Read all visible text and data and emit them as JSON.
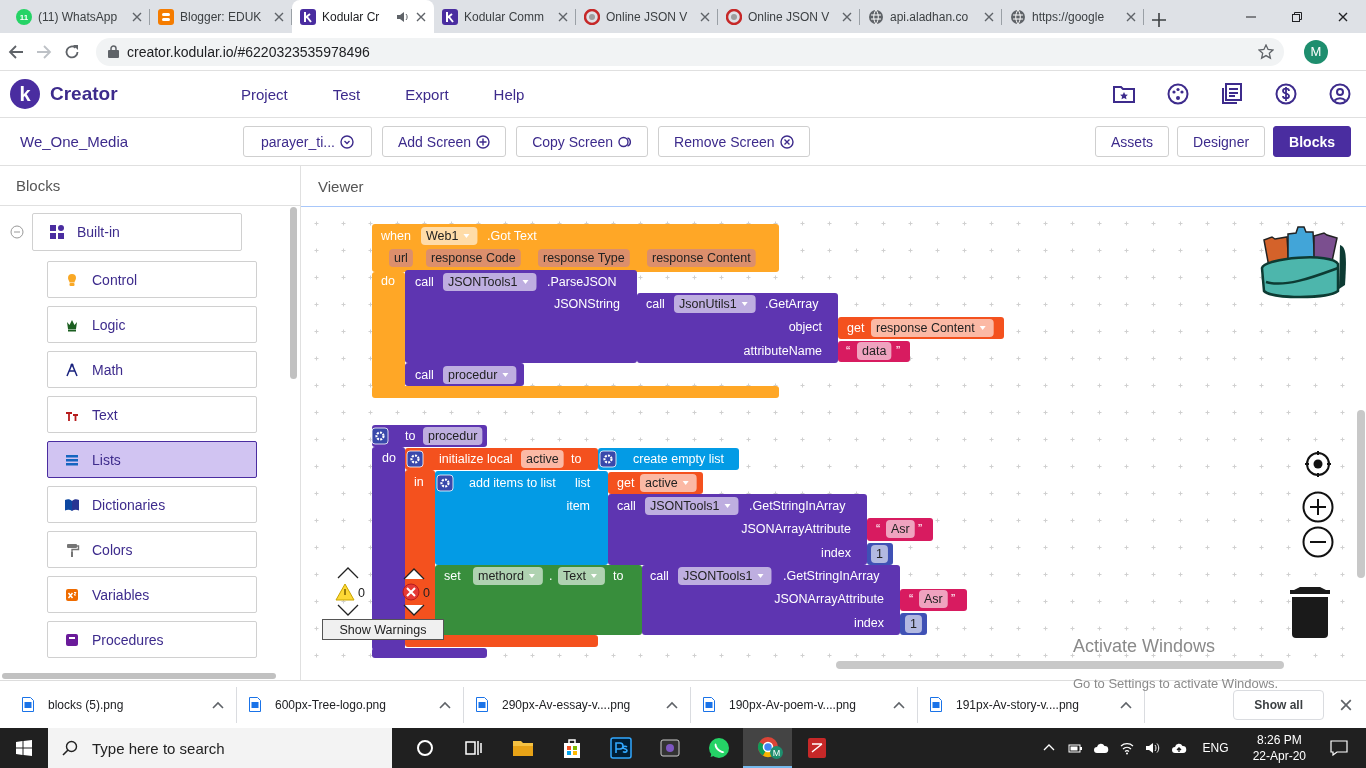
{
  "browser": {
    "tabs": [
      {
        "title": "(11) WhatsApp",
        "badge": "11",
        "selected": false,
        "audio": false
      },
      {
        "title": "Blogger: EDUK",
        "selected": false,
        "audio": false
      },
      {
        "title": "Kodular Cr",
        "selected": true,
        "audio": true
      },
      {
        "title": "Kodular Comm",
        "selected": false,
        "audio": false
      },
      {
        "title": "Online JSON V",
        "selected": false,
        "audio": false
      },
      {
        "title": "Online JSON V",
        "selected": false,
        "audio": false
      },
      {
        "title": "api.aladhan.co",
        "selected": false,
        "audio": false
      },
      {
        "title": "https://google",
        "selected": false,
        "audio": false
      }
    ],
    "address": {
      "url": "creator.kodular.io/#6220323535978496",
      "forward_enabled": false
    },
    "profile": "M"
  },
  "app": {
    "logo": "k",
    "name": "Creator",
    "menu": [
      "Project",
      "Test",
      "Export",
      "Help"
    ]
  },
  "toolbar": {
    "project": "We_One_Media",
    "screen": "parayer_ti...",
    "actions": [
      {
        "label": "Add Screen",
        "kind": "add"
      },
      {
        "label": "Copy Screen",
        "kind": "copy"
      },
      {
        "label": "Remove Screen",
        "kind": "remove"
      }
    ],
    "views": [
      {
        "label": "Assets",
        "selected": false
      },
      {
        "label": "Designer",
        "selected": false
      },
      {
        "label": "Blocks",
        "selected": true
      }
    ]
  },
  "sidebar": {
    "title": "Blocks",
    "tree": [
      {
        "label": "Built-in",
        "expanded": true,
        "selected": false,
        "children": [
          {
            "label": "Control",
            "kind": "control",
            "selected": false
          },
          {
            "label": "Logic",
            "kind": "logic",
            "selected": false
          },
          {
            "label": "Math",
            "kind": "math",
            "selected": false
          },
          {
            "label": "Text",
            "kind": "text",
            "selected": false
          },
          {
            "label": "Lists",
            "kind": "lists",
            "selected": true
          },
          {
            "label": "Dictionaries",
            "kind": "dictionaries",
            "selected": false
          },
          {
            "label": "Colors",
            "kind": "colors",
            "selected": false
          },
          {
            "label": "Variables",
            "kind": "variables",
            "selected": false
          },
          {
            "label": "Procedures",
            "kind": "procedures",
            "selected": false
          }
        ]
      }
    ]
  },
  "viewer": {
    "title": "Viewer"
  },
  "workspace": {
    "blocks": [
      {
        "color": "#ffa726",
        "labels": [
          {
            "kind": "label",
            "text": "when"
          },
          {
            "kind": "dropdown",
            "text": "Web1"
          },
          {
            "kind": "label",
            "text": ".Got Text"
          },
          {
            "kind": "param",
            "text": "url"
          },
          {
            "kind": "param",
            "text": "response Code"
          },
          {
            "kind": "param",
            "text": "response Type"
          },
          {
            "kind": "param",
            "text": "response Content"
          },
          {
            "kind": "label",
            "text": "do"
          }
        ]
      },
      {
        "color": "#5e35b1",
        "labels": [
          {
            "kind": "label",
            "text": "call"
          },
          {
            "kind": "dropdown",
            "text": "JSONTools1"
          },
          {
            "kind": "label",
            "text": ".ParseJSON"
          },
          {
            "kind": "label",
            "text": "JSONString"
          }
        ]
      },
      {
        "color": "#5e35b1",
        "labels": [
          {
            "kind": "label",
            "text": "call"
          },
          {
            "kind": "dropdown",
            "text": "JsonUtils1"
          },
          {
            "kind": "label",
            "text": ".GetArray"
          },
          {
            "kind": "label",
            "text": "object"
          },
          {
            "kind": "label",
            "text": "attributeName"
          }
        ]
      },
      {
        "color": "#f4511e",
        "labels": [
          {
            "kind": "label",
            "text": "get"
          },
          {
            "kind": "dropdown",
            "text": "response Content"
          }
        ]
      },
      {
        "color": "#d81b60",
        "labels": [
          {
            "kind": "label",
            "text": "“"
          },
          {
            "kind": "field",
            "text": "data"
          },
          {
            "kind": "label",
            "text": "”"
          }
        ]
      },
      {
        "color": "#5e35b1",
        "labels": [
          {
            "kind": "label",
            "text": "call"
          },
          {
            "kind": "dropdown",
            "text": "procedur"
          }
        ]
      },
      {
        "color": "#5e35b1",
        "gear": true,
        "labels": [
          {
            "kind": "label",
            "text": "to"
          },
          {
            "kind": "field",
            "text": "procedur"
          },
          {
            "kind": "label",
            "text": "do"
          }
        ]
      },
      {
        "color": "#f4511e",
        "gear": true,
        "labels": [
          {
            "kind": "label",
            "text": "initialize local"
          },
          {
            "kind": "field",
            "text": "active"
          },
          {
            "kind": "label",
            "text": "to"
          },
          {
            "kind": "label",
            "text": "in"
          }
        ]
      },
      {
        "color": "#039be5",
        "gear": true,
        "labels": [
          {
            "kind": "label",
            "text": "create empty list"
          }
        ]
      },
      {
        "color": "#039be5",
        "gear": true,
        "labels": [
          {
            "kind": "label",
            "text": "add items to list"
          },
          {
            "kind": "label",
            "text": "list"
          },
          {
            "kind": "label",
            "text": "item"
          }
        ]
      },
      {
        "color": "#f4511e",
        "labels": [
          {
            "kind": "label",
            "text": "get"
          },
          {
            "kind": "dropdown",
            "text": "active"
          }
        ]
      },
      {
        "color": "#5e35b1",
        "labels": [
          {
            "kind": "label",
            "text": "call"
          },
          {
            "kind": "dropdown",
            "text": "JSONTools1"
          },
          {
            "kind": "label",
            "text": ".GetStringInArray"
          },
          {
            "kind": "label",
            "text": "JSONArrayAttribute"
          },
          {
            "kind": "label",
            "text": "index"
          }
        ]
      },
      {
        "color": "#d81b60",
        "labels": [
          {
            "kind": "label",
            "text": "“"
          },
          {
            "kind": "field",
            "text": "Asr"
          },
          {
            "kind": "label",
            "text": "”"
          }
        ]
      },
      {
        "color": "#3f51b5",
        "labels": [
          {
            "kind": "field",
            "text": "1"
          }
        ]
      },
      {
        "color": "#388e3c",
        "labels": [
          {
            "kind": "label",
            "text": "set"
          },
          {
            "kind": "dropdown",
            "text": "methord"
          },
          {
            "kind": "label",
            "text": "."
          },
          {
            "kind": "dropdown",
            "text": "Text"
          },
          {
            "kind": "label",
            "text": "to"
          }
        ]
      },
      {
        "color": "#5e35b1",
        "labels": [
          {
            "kind": "label",
            "text": "call"
          },
          {
            "kind": "dropdown",
            "text": "JSONTools1"
          },
          {
            "kind": "label",
            "text": ".GetStringInArray"
          },
          {
            "kind": "label",
            "text": "JSONArrayAttribute"
          },
          {
            "kind": "label",
            "text": "index"
          }
        ]
      },
      {
        "color": "#d81b60",
        "labels": [
          {
            "kind": "label",
            "text": "“"
          },
          {
            "kind": "field",
            "text": "Asr"
          },
          {
            "kind": "label",
            "text": "”"
          }
        ]
      },
      {
        "color": "#3f51b5",
        "labels": [
          {
            "kind": "field",
            "text": "1"
          }
        ]
      }
    ],
    "indicators": {
      "warnings": "0",
      "errors": "0"
    },
    "show_warnings": "Show Warnings"
  },
  "downloads": {
    "items": [
      "blocks (5).png",
      "600px-Tree-logo.png",
      "290px-Av-essay-v....png",
      "190px-Av-poem-v....png",
      "191px-Av-story-v....png"
    ],
    "show_all": "Show all"
  },
  "taskbar": {
    "search_placeholder": "Type here to search",
    "apps": [
      {
        "kind": "cortana",
        "active": false
      },
      {
        "kind": "task-view",
        "active": false
      },
      {
        "kind": "folder",
        "active": false
      },
      {
        "kind": "store",
        "active": false
      },
      {
        "kind": "photoshop",
        "active": false
      },
      {
        "kind": "media",
        "active": false
      },
      {
        "kind": "whatsapp",
        "active": false
      },
      {
        "kind": "chrome",
        "active": true,
        "badge": "M"
      },
      {
        "kind": "pdf",
        "active": false
      }
    ],
    "language": "ENG",
    "time": "8:26 PM",
    "date": "22-Apr-20"
  },
  "os_notice": {
    "title": "Activate Windows",
    "message": "Go to Settings to activate Windows."
  }
}
